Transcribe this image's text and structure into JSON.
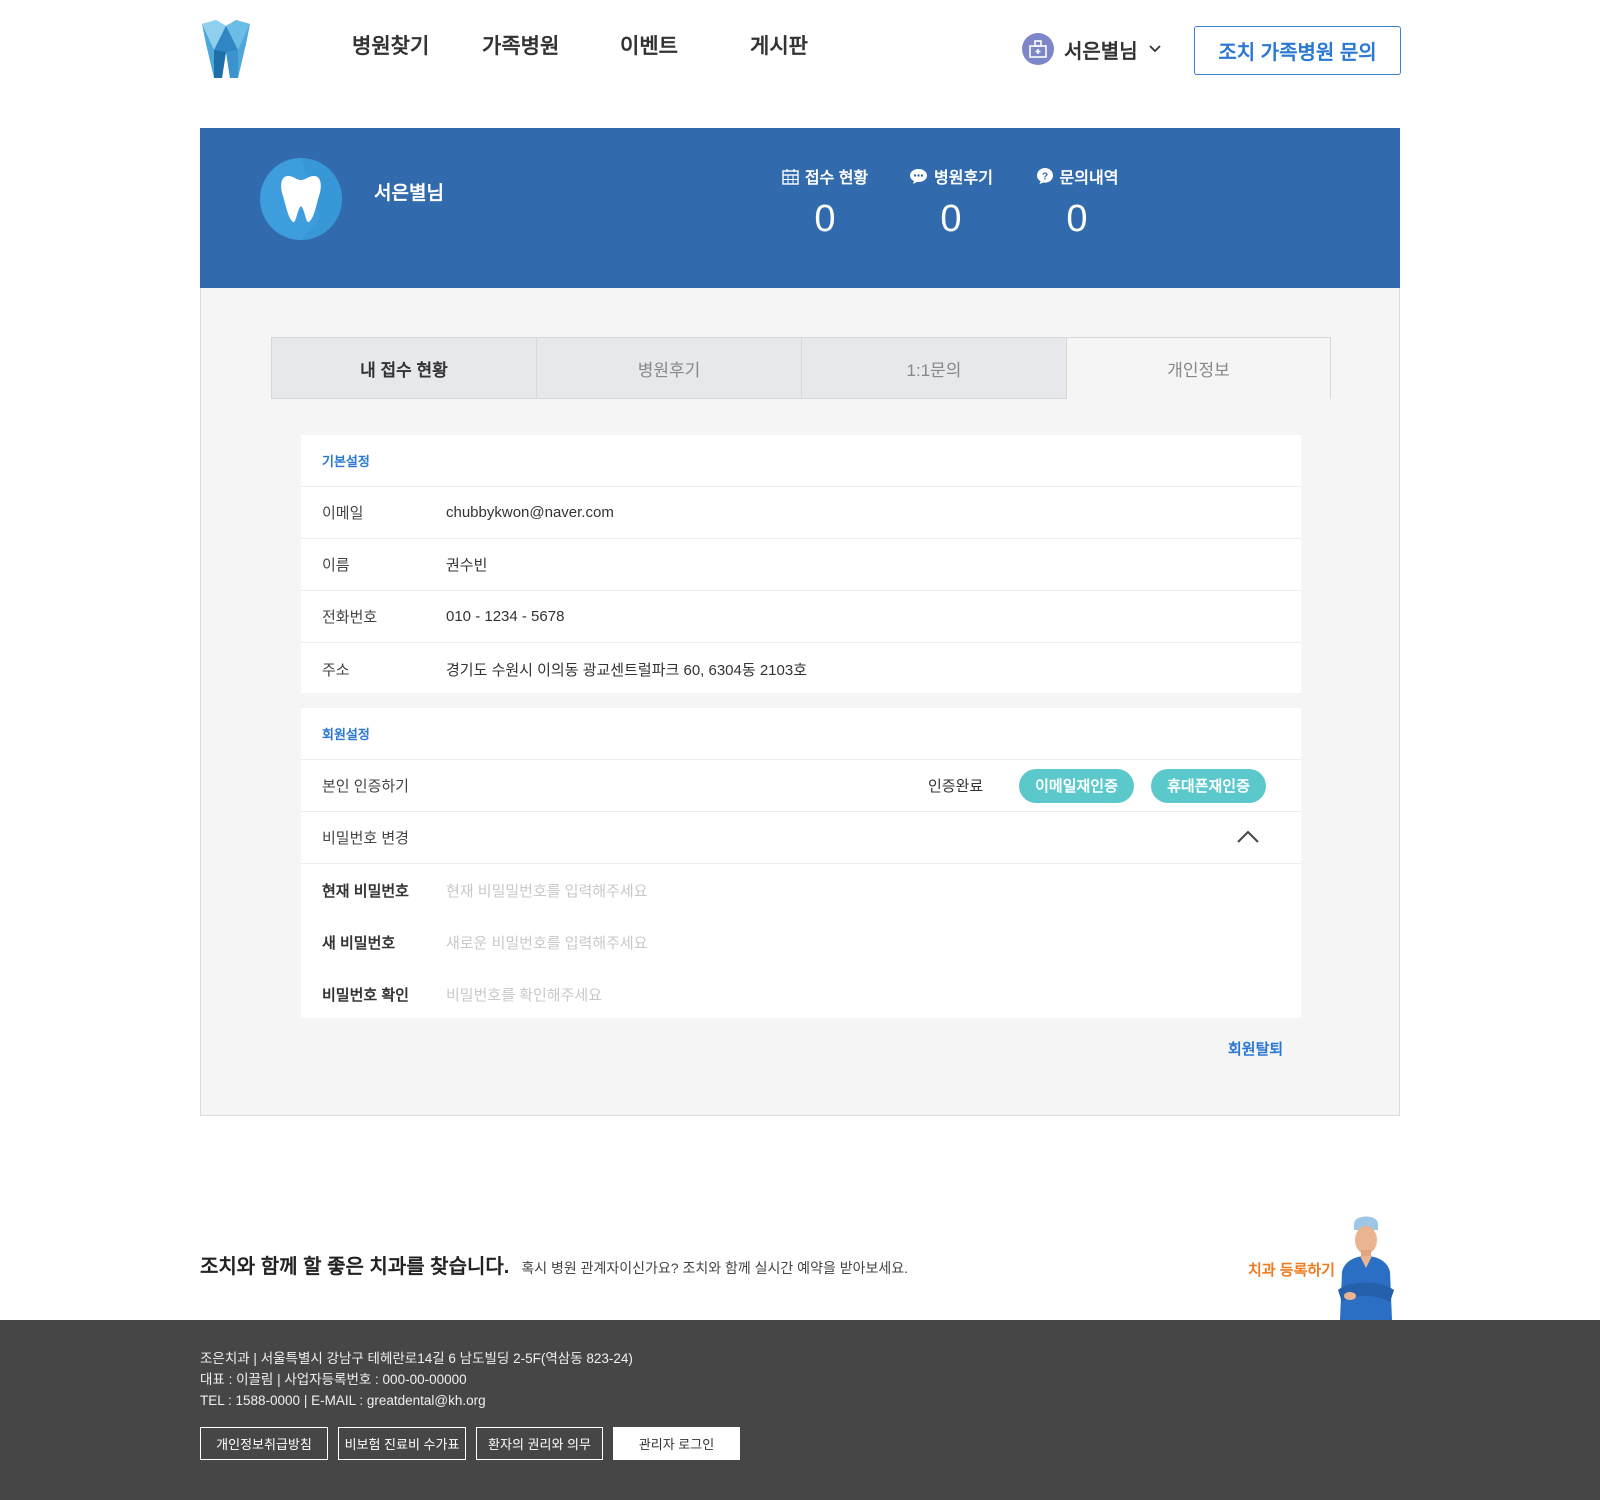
{
  "header": {
    "nav": [
      "병원찾기",
      "가족병원",
      "이벤트",
      "게시판"
    ],
    "user_name": "서은별님",
    "inquiry_label": "조치 가족병원 문의"
  },
  "banner": {
    "name": "서은별님",
    "stats": [
      {
        "label": "접수 현황",
        "value": "0"
      },
      {
        "label": "병원후기",
        "value": "0"
      },
      {
        "label": "문의내역",
        "value": "0"
      }
    ]
  },
  "tabs": [
    "내 접수 현황",
    "병원후기",
    "1:1문의",
    "개인정보"
  ],
  "basic": {
    "title": "기본설정",
    "rows": [
      {
        "label": "이메일",
        "value": "chubbykwon@naver.com"
      },
      {
        "label": "이름",
        "value": "권수빈"
      },
      {
        "label": "전화번호",
        "value": "010 - 1234 - 5678"
      },
      {
        "label": "주소",
        "value": "경기도 수원시 이의동 광교센트럴파크 60, 6304동 2103호"
      }
    ]
  },
  "member": {
    "title": "회원설정",
    "verify_label": "본인 인증하기",
    "verify_status": "인증완료",
    "email_reverify": "이메일재인증",
    "phone_reverify": "휴대폰재인증",
    "pw_change_label": "비밀번호 변경",
    "current_pw_label": "현재 비밀번호",
    "current_pw_placeholder": "현재 비밀밀번호를 입력해주세요",
    "new_pw_label": "새 비밀번호",
    "new_pw_placeholder": "새로운 비밀번호를 입력해주세요",
    "confirm_pw_label": "비밀번호 확인",
    "confirm_pw_placeholder": "비밀번호를 확인해주세요",
    "withdraw": "회원탈퇴"
  },
  "promo": {
    "title": "조치와 함께 할 좋은 치과를 찾습니다.",
    "subtitle": "혹시 병원 관계자이신가요?  조치와 함께 실시간 예약을 받아보세요.",
    "register": "치과 등록하기"
  },
  "footer": {
    "line1": "조은치과 | 서울특별시 강남구 테헤란로14길 6 남도빌딩 2-5F(역삼동 823-24)",
    "line2": "대표 : 이끌림 | 사업자등록번호 : 000-00-00000",
    "line3": "TEL : 1588-0000 | E-MAIL : greatdental@kh.org",
    "buttons": [
      "개인정보취급방침",
      "비보험 진료비 수가표",
      "환자의 권리와 의무",
      "관리자 로그인"
    ]
  },
  "colors": {
    "primary": "#316bad",
    "accent": "#2a78d2",
    "pill": "#5bc8cc",
    "orange": "#f07b1f",
    "footer": "#464646"
  }
}
